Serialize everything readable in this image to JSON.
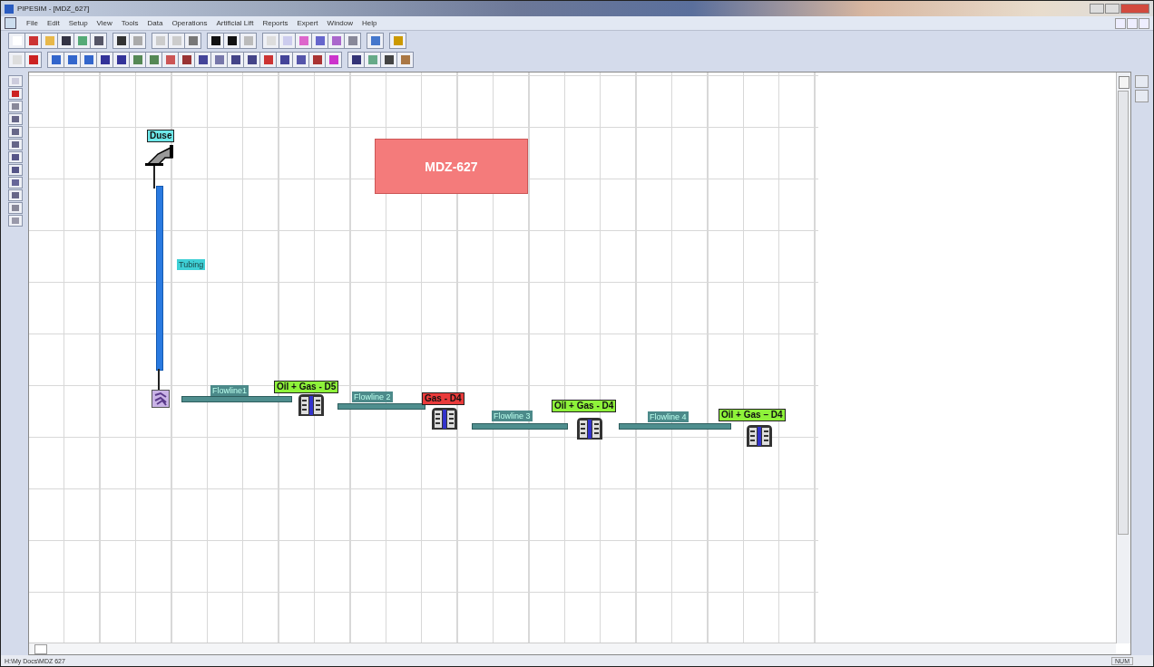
{
  "window": {
    "title": "PIPESIM - [MDZ_627]"
  },
  "menu": [
    "File",
    "Edit",
    "Setup",
    "View",
    "Tools",
    "Data",
    "Operations",
    "Artificial Lift",
    "Reports",
    "Expert",
    "Window",
    "Help"
  ],
  "diagram": {
    "banner": "MDZ-627",
    "elements": [
      {
        "kind": "choke",
        "label": "Duse",
        "color": "#6ee8ea"
      },
      {
        "kind": "tubing",
        "label": "Tubing",
        "color": "#3fd0d6"
      },
      {
        "kind": "well"
      },
      {
        "kind": "flowline",
        "label": "Flowline1"
      },
      {
        "kind": "sink",
        "label": "Oil + Gas - D5",
        "color": "#8ef23a"
      },
      {
        "kind": "flowline",
        "label": "Flowline 2"
      },
      {
        "kind": "sink",
        "label": "Gas - D4",
        "color": "#ea3b3b"
      },
      {
        "kind": "flowline",
        "label": "Flowline 3"
      },
      {
        "kind": "sink",
        "label": "Oil + Gas - D4",
        "color": "#8ef23a"
      },
      {
        "kind": "flowline",
        "label": "Flowline 4"
      },
      {
        "kind": "sink",
        "label": "Oil + Gas – D4",
        "color": "#8ef23a"
      }
    ]
  },
  "status_bar": {
    "path": "H:\\My Docs\\MDZ 627",
    "indicator": "NUM"
  }
}
